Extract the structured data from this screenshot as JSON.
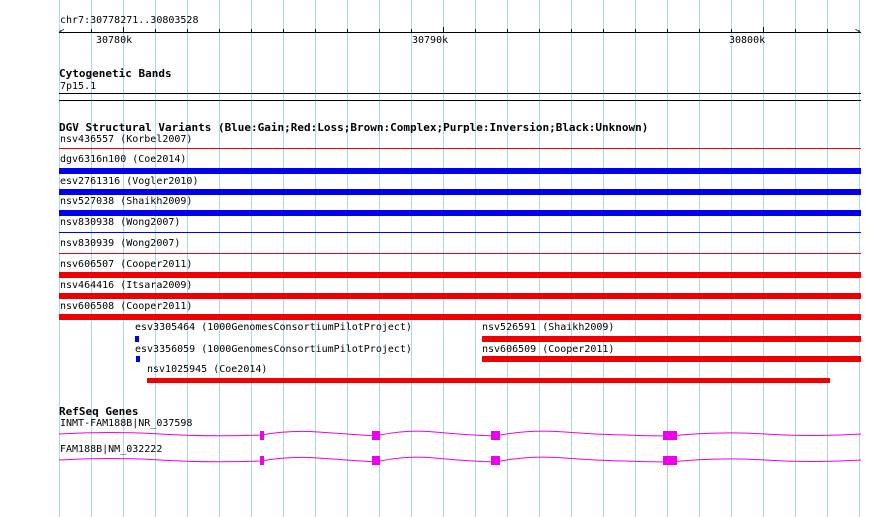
{
  "browser": {
    "position": "chr7:30778271..30803528",
    "ruler_labels": [
      "30780k",
      "30790k",
      "30800k"
    ],
    "colors": {
      "gain": "#0000ee",
      "loss": "#ee0000",
      "gene": "#ee00ee",
      "grid": "#a9d8ef"
    }
  },
  "cytobands": {
    "title": "Cytogenetic Bands",
    "band": "7p15.1"
  },
  "dgv": {
    "title": "DGV Structural Variants (Blue:Gain;Red:Loss;Brown:Complex;Purple:Inversion;Black:Unknown)",
    "variants": [
      {
        "label": "nsv436557 (Korbel2007)",
        "type": "loss"
      },
      {
        "label": "dgv6316n100 (Coe2014)",
        "type": "gain"
      },
      {
        "label": "esv2761316 (Vogler2010)",
        "type": "gain"
      },
      {
        "label": "nsv527038 (Shaikh2009)",
        "type": "gain"
      },
      {
        "label": "nsv830938 (Wong2007)",
        "type": "gain"
      },
      {
        "label": "nsv830939 (Wong2007)",
        "type": "loss"
      },
      {
        "label": "nsv606507 (Cooper2011)",
        "type": "loss"
      },
      {
        "label": "nsv464416 (Itsara2009)",
        "type": "loss"
      },
      {
        "label": "nsv606508 (Cooper2011)",
        "type": "loss"
      },
      {
        "label": "esv3305464 (1000GenomesConsortiumPilotProject)",
        "type": "gain"
      },
      {
        "label": "esv3356059 (1000GenomesConsortiumPilotProject)",
        "type": "gain"
      },
      {
        "label": "nsv526591 (Shaikh2009)",
        "type": "loss"
      },
      {
        "label": "nsv606509 (Cooper2011)",
        "type": "loss"
      },
      {
        "label": "nsv1025945 (Coe2014)",
        "type": "loss"
      }
    ]
  },
  "refseq": {
    "title": "RefSeq Genes",
    "genes": [
      {
        "label": "INMT-FAM188B|NR_037598"
      },
      {
        "label": "FAM188B|NM_032222"
      }
    ]
  }
}
